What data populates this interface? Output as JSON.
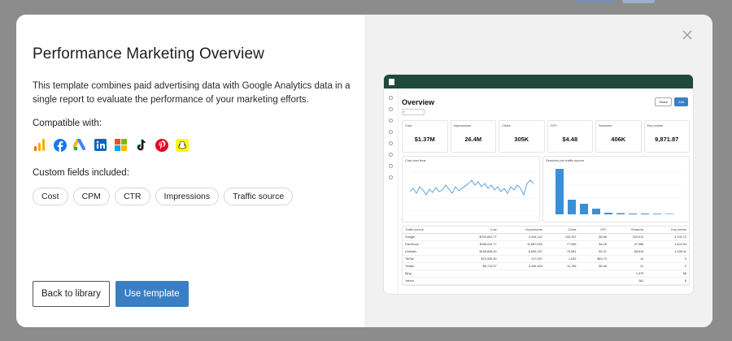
{
  "modal": {
    "title": "Performance Marketing Overview",
    "description": "This template combines paid advertising data with Google Analytics data in a single report to evaluate the performance of your marketing efforts.",
    "compatible_label": "Compatible with:",
    "compatible_icons": [
      "google-analytics-icon",
      "facebook-icon",
      "google-ads-icon",
      "linkedin-icon",
      "microsoft-ads-icon",
      "tiktok-icon",
      "pinterest-icon",
      "snapchat-icon"
    ],
    "custom_fields_label": "Custom fields included:",
    "custom_fields": [
      "Cost",
      "CPM",
      "CTR",
      "Impressions",
      "Traffic source"
    ],
    "back_label": "Back to library",
    "use_label": "Use template",
    "colors": {
      "primary": "#3a7fc4",
      "preview_header": "#1f4a3a",
      "chart_line": "#3a8fd9"
    }
  },
  "preview": {
    "heading": "Overview",
    "share_label": "Share",
    "edit_label": "Edit",
    "kpis": [
      {
        "label": "Cost",
        "value": "$1.37M"
      },
      {
        "label": "Impressions",
        "value": "26.4M"
      },
      {
        "label": "Clicks",
        "value": "305K"
      },
      {
        "label": "CPC",
        "value": "$4.48"
      },
      {
        "label": "Sessions",
        "value": "406K"
      },
      {
        "label": "Key events",
        "value": "9,871.87"
      }
    ],
    "line_chart_title": "Cost over time",
    "bar_chart_title": "Sessions per traffic source",
    "table": {
      "headers": [
        "Traffic source",
        "Cost",
        "Impressions",
        "Clicks",
        "CPC",
        "Sessions",
        "Key events"
      ],
      "rows": [
        [
          "Google",
          "$700,824.77",
          "4,344,142",
          "134,337",
          "$5.66",
          "220,012",
          "4,100.72"
        ],
        [
          "Facebook",
          "$336,011.77",
          "11,887,053",
          "77,556",
          "$4.28",
          "47,986",
          "1,424.34"
        ],
        [
          "LinkedIn",
          "$198,826.50",
          "6,590,157",
          "79,551",
          "$2.47",
          "58,515",
          "1,198.41"
        ],
        [
          "TikTok",
          "$70,000.50",
          "117,057",
          "1,532",
          "$45.73",
          "14",
          "0"
        ],
        [
          "Twitter",
          "$5,713.57",
          "3,490,453",
          "11,796",
          "$0.48",
          "21",
          "0"
        ],
        [
          "Bing",
          "",
          "",
          "",
          "",
          "1,479",
          "58"
        ],
        [
          "Yahoo",
          "",
          "",
          "",
          "",
          "161",
          "8"
        ]
      ]
    }
  }
}
